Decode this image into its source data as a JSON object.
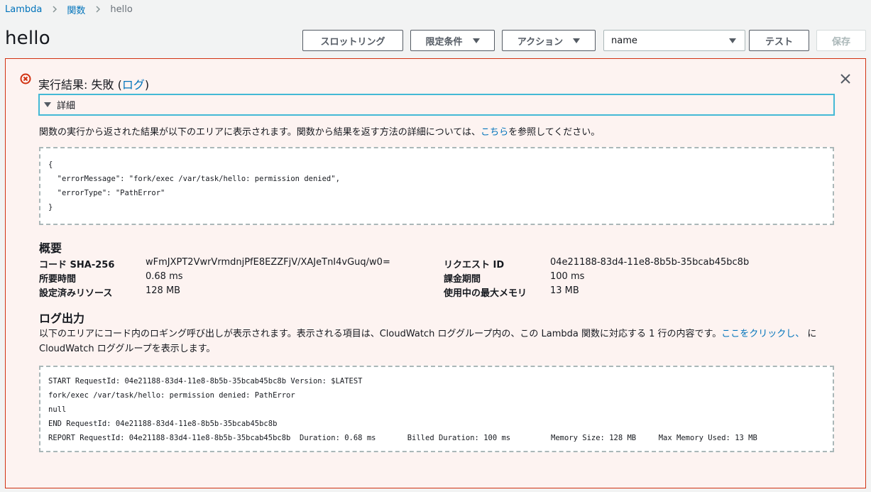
{
  "breadcrumb": {
    "items": [
      "Lambda",
      "関数"
    ],
    "current": "hello"
  },
  "page": {
    "title": "hello"
  },
  "toolbar": {
    "throttle_label": "スロットリング",
    "qualifiers_label": "限定条件",
    "actions_label": "アクション",
    "test_event_value": "name",
    "test_label": "テスト",
    "save_label": "保存"
  },
  "result": {
    "title_prefix": "実行結果: 失敗 (",
    "log_link": "ログ",
    "title_suffix": ")",
    "details_label": "詳細",
    "description_prefix": "関数の実行から返された結果が以下のエリアに表示されます。関数から結果を返す方法の詳細については、",
    "description_link": "こちら",
    "description_suffix": "を参照してください。",
    "output": "{\n  \"errorMessage\": \"fork/exec /var/task/hello: permission denied\",\n  \"errorType\": \"PathError\"\n}"
  },
  "summary": {
    "title": "概要",
    "code_sha_label_prefix": "コード ",
    "code_sha_label_bold": "SHA-256",
    "code_sha_value": "wFmJXPT2VwrVrmdnjPfE8EZZFjV/XAJeTnI4vGuq/w0=",
    "request_id_label": "リクエスト ID",
    "request_id_value": "04e21188-83d4-11e8-8b5b-35bcab45bc8b",
    "duration_label": "所要時間",
    "duration_value": "0.68 ms",
    "billed_label": "課金期間",
    "billed_value": "100 ms",
    "resources_label": "設定済みリソース",
    "resources_value": "128 MB",
    "max_memory_label": "使用中の最大メモリ",
    "max_memory_value": "13 MB"
  },
  "logs": {
    "title": "ログ出力",
    "description_prefix": "以下のエリアにコード内のロギング呼び出しが表示されます。表示される項目は、CloudWatch ロググループ内の、この Lambda 関数に対応する 1 行の内容です。",
    "description_link": "ここをクリックし、",
    "description_suffix": " に CloudWatch ロググループを表示します。",
    "output": "START RequestId: 04e21188-83d4-11e8-8b5b-35bcab45bc8b Version: $LATEST\nfork/exec /var/task/hello: permission denied: PathError\nnull\nEND RequestId: 04e21188-83d4-11e8-8b5b-35bcab45bc8b\nREPORT RequestId: 04e21188-83d4-11e8-8b5b-35bcab45bc8b  Duration: 0.68 ms       Billed Duration: 100 ms         Memory Size: 128 MB     Max Memory Used: 13 MB"
  },
  "colors": {
    "link": "#0073bb",
    "error": "#d13212",
    "panel_bg": "#fdf3f1",
    "focus": "#44b9d6"
  }
}
